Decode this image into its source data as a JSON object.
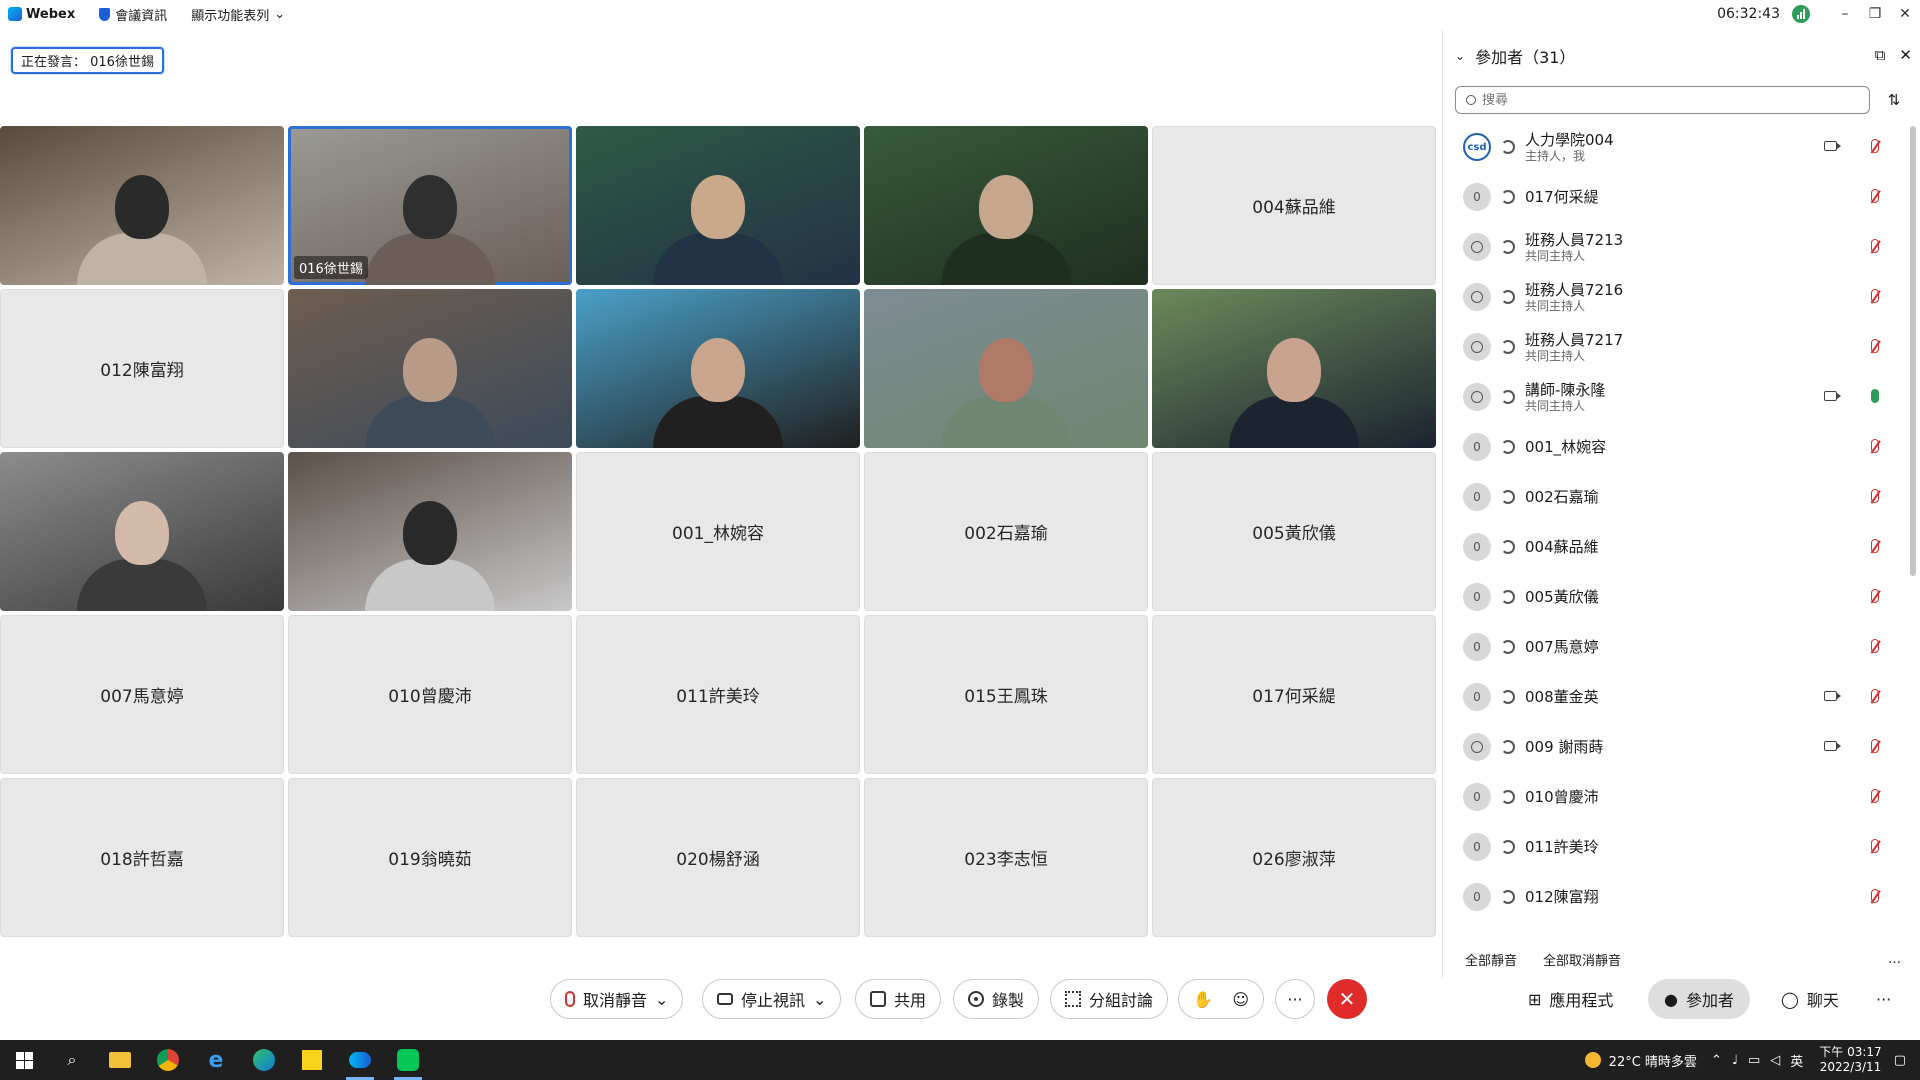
{
  "titlebar": {
    "app_name": "Webex",
    "meeting_info": "會議資訊",
    "menu_toggle": "顯示功能表列",
    "time": "06:32:43"
  },
  "speaking": "正在發言： 016徐世錫",
  "tiles": [
    {
      "type": "video",
      "label": ""
    },
    {
      "type": "video",
      "label": "016徐世錫",
      "active": true
    },
    {
      "type": "video",
      "label": ""
    },
    {
      "type": "video",
      "label": ""
    },
    {
      "type": "name",
      "label": "004蘇品維"
    },
    {
      "type": "name",
      "label": "012陳富翔"
    },
    {
      "type": "video",
      "label": ""
    },
    {
      "type": "video",
      "label": ""
    },
    {
      "type": "video",
      "label": ""
    },
    {
      "type": "video",
      "label": ""
    },
    {
      "type": "video",
      "label": ""
    },
    {
      "type": "video",
      "label": ""
    },
    {
      "type": "name",
      "label": "001_林婉容"
    },
    {
      "type": "name",
      "label": "002石嘉瑜"
    },
    {
      "type": "name",
      "label": "005黃欣儀"
    },
    {
      "type": "name",
      "label": "007馬意婷"
    },
    {
      "type": "name",
      "label": "010曾慶沛"
    },
    {
      "type": "name",
      "label": "011許美玲"
    },
    {
      "type": "name",
      "label": "015王鳳珠"
    },
    {
      "type": "name",
      "label": "017何采緹"
    },
    {
      "type": "name",
      "label": "018許哲嘉"
    },
    {
      "type": "name",
      "label": "019翁曉茹"
    },
    {
      "type": "name",
      "label": "020楊舒涵"
    },
    {
      "type": "name",
      "label": "023李志恒"
    },
    {
      "type": "name",
      "label": "026廖淑萍"
    }
  ],
  "panel": {
    "title": "參加者（31）",
    "search_placeholder": "搜尋",
    "participants": [
      {
        "name": "人力學院004",
        "sub": "主持人，我",
        "avatar": "csd",
        "avatar_text": "csd",
        "cam": true,
        "mic": "muted"
      },
      {
        "name": "017何采緹",
        "sub": "",
        "avatar": "letter",
        "avatar_text": "0",
        "cam": false,
        "mic": "muted"
      },
      {
        "name": "班務人員7213",
        "sub": "共同主持人",
        "avatar": "user",
        "avatar_text": "",
        "cam": false,
        "mic": "muted"
      },
      {
        "name": "班務人員7216",
        "sub": "共同主持人",
        "avatar": "user",
        "avatar_text": "",
        "cam": false,
        "mic": "muted"
      },
      {
        "name": "班務人員7217",
        "sub": "共同主持人",
        "avatar": "user",
        "avatar_text": "",
        "cam": false,
        "mic": "muted"
      },
      {
        "name": "講師-陳永隆",
        "sub": "共同主持人",
        "avatar": "user",
        "avatar_text": "",
        "cam": true,
        "mic": "on"
      },
      {
        "name": "001_林婉容",
        "sub": "",
        "avatar": "letter",
        "avatar_text": "0",
        "cam": false,
        "mic": "muted"
      },
      {
        "name": "002石嘉瑜",
        "sub": "",
        "avatar": "letter",
        "avatar_text": "0",
        "cam": false,
        "mic": "muted"
      },
      {
        "name": "004蘇品維",
        "sub": "",
        "avatar": "letter",
        "avatar_text": "0",
        "cam": false,
        "mic": "muted"
      },
      {
        "name": "005黃欣儀",
        "sub": "",
        "avatar": "letter",
        "avatar_text": "0",
        "cam": false,
        "mic": "muted"
      },
      {
        "name": "007馬意婷",
        "sub": "",
        "avatar": "letter",
        "avatar_text": "0",
        "cam": false,
        "mic": "muted"
      },
      {
        "name": "008董金英",
        "sub": "",
        "avatar": "letter",
        "avatar_text": "0",
        "cam": true,
        "mic": "muted"
      },
      {
        "name": "009 謝雨蒔",
        "sub": "",
        "avatar": "user",
        "avatar_text": "",
        "cam": true,
        "mic": "muted"
      },
      {
        "name": "010曾慶沛",
        "sub": "",
        "avatar": "letter",
        "avatar_text": "0",
        "cam": false,
        "mic": "muted"
      },
      {
        "name": "011許美玲",
        "sub": "",
        "avatar": "letter",
        "avatar_text": "0",
        "cam": false,
        "mic": "muted"
      },
      {
        "name": "012陳富翔",
        "sub": "",
        "avatar": "letter",
        "avatar_text": "0",
        "cam": false,
        "mic": "muted"
      }
    ],
    "mute_all": "全部靜音",
    "unmute_all": "全部取消靜音",
    "more": "…"
  },
  "controls": {
    "unmute": "取消靜音",
    "stop_video": "停止視訊",
    "share": "共用",
    "record": "錄製",
    "breakout": "分組討論",
    "more": "···",
    "apps": "應用程式",
    "participants": "參加者",
    "chat": "聊天",
    "overflow": "···"
  },
  "taskbar": {
    "weather": "22°C  晴時多雲",
    "ime": "英",
    "time": "下午 03:17",
    "date": "2022/3/11"
  },
  "colors": {
    "accent": "#2c6fd6",
    "end_call": "#e02b2b",
    "muted": "#d43030",
    "active_mic": "#2e9c5a"
  }
}
